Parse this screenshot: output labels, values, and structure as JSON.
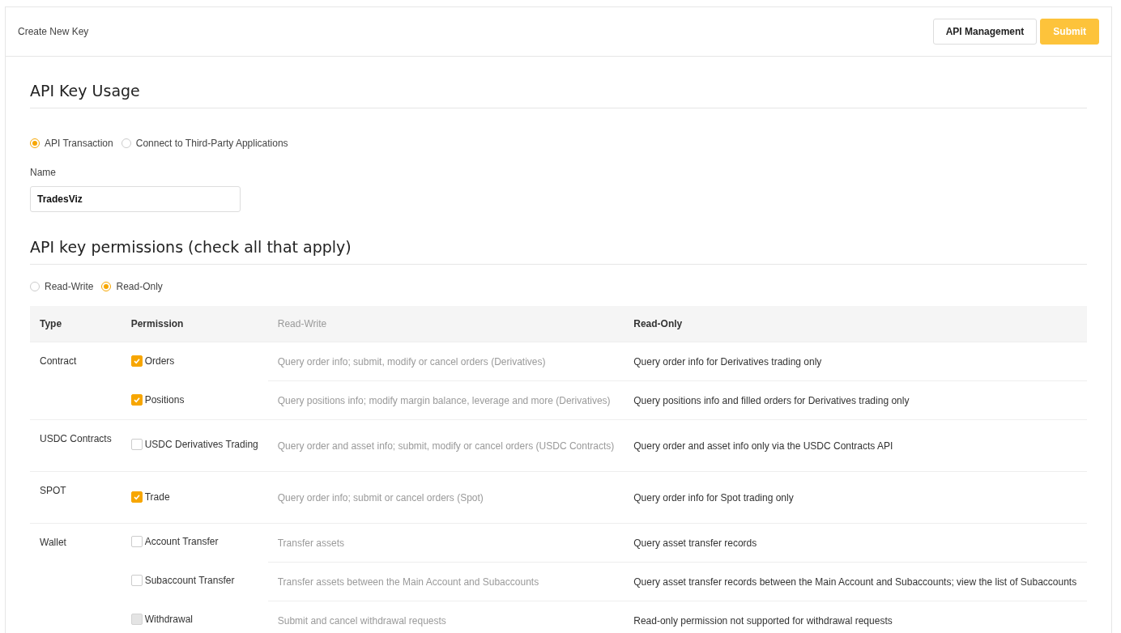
{
  "header": {
    "title": "Create New Key",
    "buttons": [
      {
        "label": "API Management",
        "kind": "secondary"
      },
      {
        "label": "Submit",
        "kind": "primary"
      }
    ]
  },
  "usage": {
    "heading": "API Key Usage",
    "options": [
      {
        "label": "API Transaction",
        "selected": true
      },
      {
        "label": "Connect to Third-Party Applications",
        "selected": false
      }
    ],
    "name_label": "Name",
    "name_value": "TradesViz"
  },
  "permissions": {
    "heading": "API key permissions (check all that apply)",
    "modes": [
      {
        "label": "Read-Write",
        "selected": false
      },
      {
        "label": "Read-Only",
        "selected": true
      }
    ],
    "table": {
      "columns": [
        "Type",
        "Permission",
        "Read-Write",
        "Read-Only"
      ],
      "groups": [
        {
          "type": "Contract",
          "rows": [
            {
              "permission": "Orders",
              "checked": true,
              "disabled": false,
              "read_write": "Query order info; submit, modify or cancel orders (Derivatives)",
              "read_only": "Query order info for Derivatives trading only"
            },
            {
              "permission": "Positions",
              "checked": true,
              "disabled": false,
              "read_write": "Query positions info; modify margin balance, leverage and more (Derivatives)",
              "read_only": "Query positions info and filled orders for Derivatives trading only"
            }
          ]
        },
        {
          "type": "USDC Contracts",
          "rows": [
            {
              "permission": "USDC Derivatives Trading",
              "checked": false,
              "disabled": false,
              "read_write": "Query order and asset info; submit, modify or cancel orders (USDC Contracts)",
              "read_only": "Query order and asset info only via the USDC Contracts API"
            }
          ]
        },
        {
          "type": "SPOT",
          "rows": [
            {
              "permission": "Trade",
              "checked": true,
              "disabled": false,
              "read_write": "Query order info; submit or cancel orders (Spot)",
              "read_only": "Query order info for Spot trading only"
            }
          ]
        },
        {
          "type": "Wallet",
          "rows": [
            {
              "permission": "Account Transfer",
              "checked": false,
              "disabled": false,
              "read_write": "Transfer assets",
              "read_only": "Query asset transfer records"
            },
            {
              "permission": "Subaccount Transfer",
              "checked": false,
              "disabled": false,
              "read_write": "Transfer assets between the Main Account and Subaccounts",
              "read_only": "Query asset transfer records between the Main Account and Subaccounts; view the list of Subaccounts"
            },
            {
              "permission": "Withdrawal",
              "checked": false,
              "disabled": true,
              "read_write": "Submit and cancel withdrawal requests",
              "read_only": "Read-only permission not supported for withdrawal requests"
            }
          ]
        }
      ]
    }
  }
}
